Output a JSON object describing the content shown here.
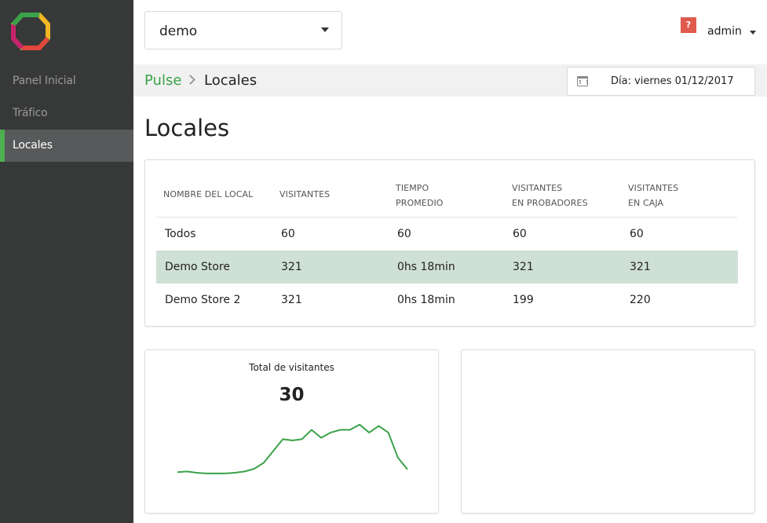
{
  "sidebar": {
    "items": [
      {
        "label": "Panel Inicial",
        "active": false
      },
      {
        "label": "Tráfico",
        "active": false
      },
      {
        "label": "Locales",
        "active": true
      }
    ]
  },
  "store_selector": {
    "value": "demo"
  },
  "header": {
    "help_label": "?",
    "user_label": "admin"
  },
  "breadcrumb": {
    "root": "Pulse",
    "current": "Locales"
  },
  "date_filter": {
    "label": "Día: viernes 01/12/2017"
  },
  "page": {
    "title": "Locales"
  },
  "table": {
    "columns": [
      [
        "NOMBRE DEL LOCAL"
      ],
      [
        "VISITANTES"
      ],
      [
        "TIEMPO",
        "PROMEDIO"
      ],
      [
        "VISITANTES",
        "EN PROBADORES"
      ],
      [
        "VISITANTES",
        "EN CAJA"
      ]
    ],
    "rows": [
      {
        "cells": [
          "Todos",
          "60",
          "60",
          "60",
          "60"
        ],
        "selected": false
      },
      {
        "cells": [
          "Demo Store",
          "321",
          "0hs 18min",
          "321",
          "321"
        ],
        "selected": true
      },
      {
        "cells": [
          "Demo Store 2",
          "321",
          "0hs 18min",
          "199",
          "220"
        ],
        "selected": false
      }
    ]
  },
  "visitors_card": {
    "title": "Total de visitantes",
    "value": "30",
    "line_color": "#3aa24a"
  },
  "chart_data": {
    "type": "line",
    "title": "Total de visitantes",
    "xlabel": "",
    "ylabel": "",
    "grid": false,
    "series": [
      {
        "values": [
          10,
          10.5,
          9.5,
          9,
          9,
          9,
          9.5,
          10.5,
          12.5,
          17,
          26,
          35,
          34,
          35,
          42,
          36,
          40,
          42,
          42,
          46,
          40,
          45,
          40,
          21,
          12
        ]
      }
    ],
    "ylim": [
      0,
      50
    ]
  },
  "colors": {
    "accent": "#3aa24a",
    "sidebar_bg": "#373838",
    "row_highlight": "#cfe0d6",
    "help_badge": "#e05a4e"
  }
}
